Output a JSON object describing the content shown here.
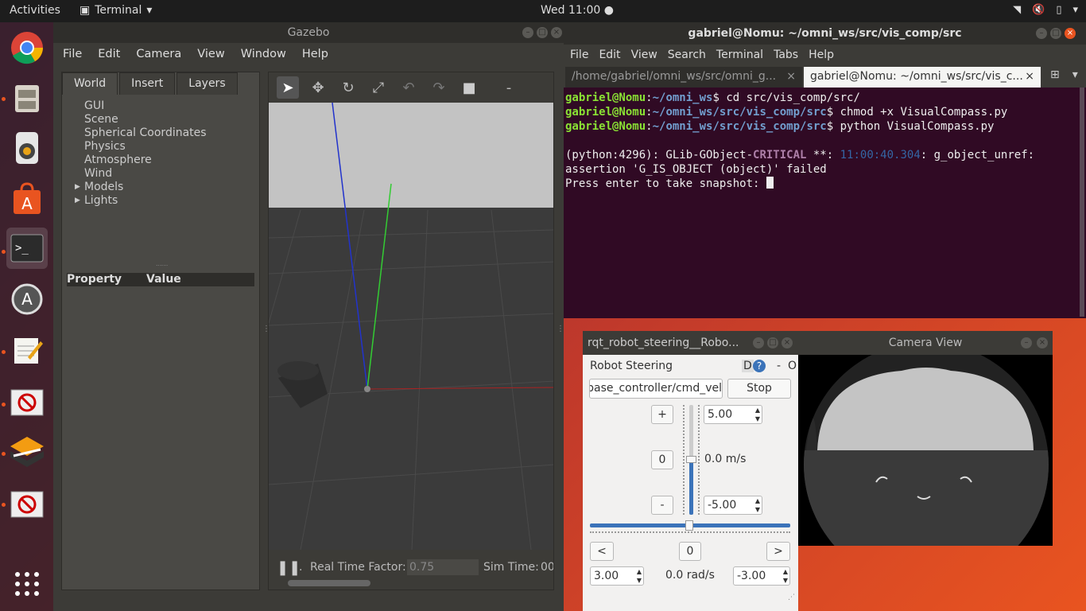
{
  "topbar": {
    "activities": "Activities",
    "app_name": "Terminal",
    "clock": "Wed 11:00"
  },
  "gazebo": {
    "title": "Gazebo",
    "menu": [
      "File",
      "Edit",
      "Camera",
      "View",
      "Window",
      "Help"
    ],
    "tabs": [
      "World",
      "Insert",
      "Layers"
    ],
    "tree": [
      "GUI",
      "Scene",
      "Spherical Coordinates",
      "Physics",
      "Atmosphere",
      "Wind",
      "Models",
      "Lights"
    ],
    "property_header": "Property",
    "value_header": "Value",
    "real_time_label": "Real Time Factor:",
    "real_time_value": "0.75",
    "sim_time_label": "Sim Time:",
    "sim_time_value": "00"
  },
  "terminal": {
    "title": "gabriel@Nomu: ~/omni_ws/src/vis_comp/src",
    "menu": [
      "File",
      "Edit",
      "View",
      "Search",
      "Terminal",
      "Tabs",
      "Help"
    ],
    "tabs": [
      "/home/gabriel/omni_ws/src/omni_g...",
      "gabriel@Nomu: ~/omni_ws/src/vis_c..."
    ],
    "lines": [
      {
        "user": "gabriel@Nomu",
        "path": "~/omni_ws",
        "cmd": "cd src/vis_comp/src/"
      },
      {
        "user": "gabriel@Nomu",
        "path": "~/omni_ws/src/vis_comp/src",
        "cmd": "chmod +x VisualCompass.py"
      },
      {
        "user": "gabriel@Nomu",
        "path": "~/omni_ws/src/vis_comp/src",
        "cmd": "python VisualCompass.py"
      }
    ],
    "err_prefix": "(python:4296): GLib-GObject-",
    "err_level": "CRITICAL",
    "err_mid": " **: ",
    "err_time": "11:00:40.304",
    "err_suffix": ": g_object_unref:",
    "err_line2": "assertion 'G_IS_OBJECT (object)' failed",
    "prompt_line": "Press enter to take snapshot: "
  },
  "rqt": {
    "title": "rqt_robot_steering__Robo...",
    "heading": "Robot Steering",
    "d_label": "D",
    "help": "?",
    "minus": "-",
    "o_label": "O",
    "topic": "base_controller/cmd_vel",
    "stop": "Stop",
    "plus_btn": "+",
    "zero_btn": "0",
    "minus_btn": "-",
    "max_linear": "5.00",
    "min_linear": "-5.00",
    "linear_readout": "0.0 m/s",
    "left_btn": "<",
    "center_btn": "0",
    "right_btn": ">",
    "max_angular": "3.00",
    "angular_readout": "0.0 rad/s",
    "min_angular": "-3.00"
  },
  "camera": {
    "title": "Camera View"
  },
  "colors": {
    "terminal_bg": "#300a24",
    "prompt_user": "#8ae234",
    "prompt_path": "#729fcf",
    "accent": "#e95420"
  }
}
